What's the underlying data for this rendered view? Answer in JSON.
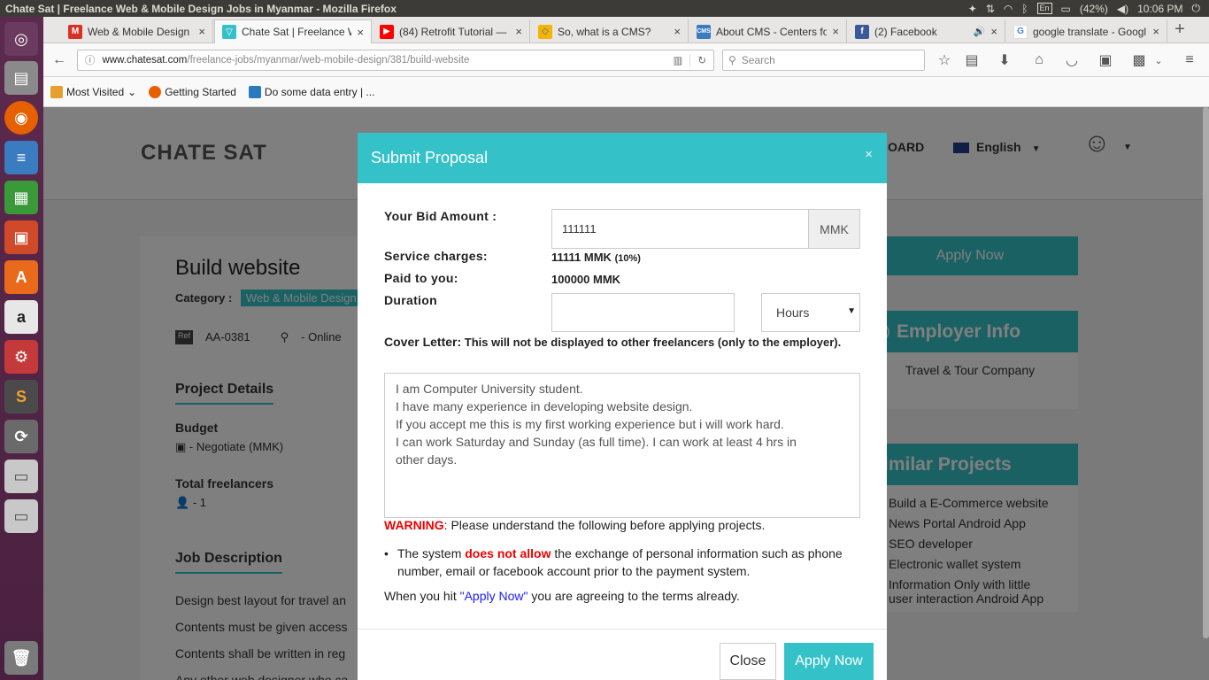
{
  "window": {
    "title": "Chate Sat | Freelance Web & Mobile Design Jobs in Myanmar - Mozilla Firefox"
  },
  "system_tray": {
    "keyboard": "En",
    "battery": "(42%)",
    "time": "10:06 PM"
  },
  "tabs": [
    {
      "label": "Web & Mobile Design Pr",
      "icon": "gmail-icon",
      "close": "×"
    },
    {
      "label": "Chate Sat | Freelance W",
      "icon": "chatesat-icon",
      "close": "×"
    },
    {
      "label": "(84) Retrofit Tutorial — ",
      "icon": "youtube-icon",
      "close": "×"
    },
    {
      "label": "So, what is a CMS?",
      "icon": "diamond-icon",
      "close": "×"
    },
    {
      "label": "About CMS - Centers for",
      "icon": "cms-icon",
      "close": "×"
    },
    {
      "label": "(2) Facebook",
      "icon": "facebook-icon",
      "close": "×"
    },
    {
      "label": "google translate - Googl",
      "icon": "google-icon",
      "close": "×"
    }
  ],
  "urlbar": {
    "host": "www.chatesat.com",
    "path": "/freelance-jobs/myanmar/web-mobile-design/381/build-website",
    "search_placeholder": "Search"
  },
  "bookmarks": [
    {
      "label": "Most Visited",
      "icon": "folder-icon"
    },
    {
      "label": "Getting Started",
      "icon": "firefox-icon"
    },
    {
      "label": "Do some data entry | ...",
      "icon": "upwork-icon"
    }
  ],
  "site": {
    "logo": "CHATE SAT",
    "nav_dashboard": "OARD",
    "language": "English",
    "job_title": "Build website",
    "category_label": "Category :",
    "category": "Web & Mobile Design",
    "ref_badge": "Ref",
    "ref": "AA-0381",
    "location": "- Online",
    "project_details": "Project Details",
    "budget_label": "Budget",
    "budget_value": "-  Negotiate (MMK)",
    "freelancers_label": "Total freelancers",
    "freelancers_value": "-  1",
    "job_description": "Job Description",
    "desc_lines": [
      "Design best layout for travel an",
      "Contents must be given access",
      "Contents shall be written in reg",
      "Any other web designer who ca"
    ],
    "apply_now": "Apply Now",
    "employer_info": "Employer Info",
    "employer": "Travel & Tour Company",
    "similar_projects": "Similar Projects",
    "similar": [
      "Build a E-Commerce website",
      "News Portal Android App",
      "SEO developer",
      "Electronic wallet system",
      "Information Only with little user interaction Android App"
    ]
  },
  "modal": {
    "title": "Submit Proposal",
    "close_x": "×",
    "bid_label": "Your Bid Amount :",
    "bid_value": "111111",
    "bid_currency": "MMK",
    "service_label": "Service charges:",
    "service_value": "11111 MMK",
    "service_pct": "(10%)",
    "paid_label": "Paid to you:",
    "paid_value": "100000 MMK",
    "duration_label": "Duration",
    "duration_value": "",
    "duration_unit": "Hours",
    "cover_label": "Cover Letter:",
    "cover_note": "This will not be displayed to other freelancers (only to the employer).",
    "cover_lines": [
      "I am Computer University student.",
      "I have many experience in developing website design.",
      "If you accept me this is my first working experience but i will work hard.",
      "I can work Saturday and Sunday (as full time). I can work at least 4 hrs in",
      "other days."
    ],
    "warning_word": "WARNING",
    "warning_text": ": Please understand the following before applying projects.",
    "rule_prefix": "The system ",
    "rule_bold": "does not allow",
    "rule_suffix": " the exchange of personal information such as phone number, email or facebook account prior to the payment system.",
    "agree_prefix": "When you hit ",
    "agree_link": "\"Apply Now\"",
    "agree_suffix": " you are agreeing to the terms already.",
    "btn_close": "Close",
    "btn_apply": "Apply Now"
  },
  "colors": {
    "accent": "#34c2c8",
    "warning": "#e00000",
    "launcher": "#5c2a4e",
    "topbar": "#3c3b37"
  }
}
